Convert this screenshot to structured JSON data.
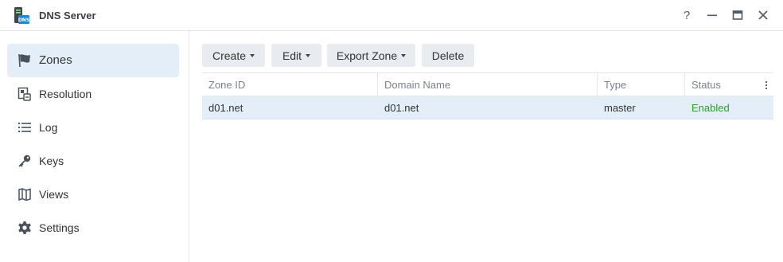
{
  "window": {
    "title": "DNS Server",
    "icon_text": "DNS",
    "controls": [
      "help",
      "minimize",
      "maximize",
      "close"
    ]
  },
  "sidebar": {
    "items": [
      {
        "label": "Zones",
        "icon": "flag-icon",
        "active": true
      },
      {
        "label": "Resolution",
        "icon": "resolution-icon",
        "active": false
      },
      {
        "label": "Log",
        "icon": "list-icon",
        "active": false
      },
      {
        "label": "Keys",
        "icon": "key-icon",
        "active": false
      },
      {
        "label": "Views",
        "icon": "map-icon",
        "active": false
      },
      {
        "label": "Settings",
        "icon": "gear-icon",
        "active": false
      }
    ]
  },
  "toolbar": {
    "create": "Create",
    "edit": "Edit",
    "export_zone": "Export Zone",
    "delete": "Delete"
  },
  "grid": {
    "columns": [
      "Zone ID",
      "Domain Name",
      "Type",
      "Status"
    ],
    "rows": [
      {
        "zone_id": "d01.net",
        "domain": "d01.net",
        "type": "master",
        "status": "Enabled"
      }
    ]
  },
  "colors": {
    "accent_bg": "#e4eef9",
    "status_enabled": "#2a9d2a",
    "button_bg": "#e8ebef"
  }
}
